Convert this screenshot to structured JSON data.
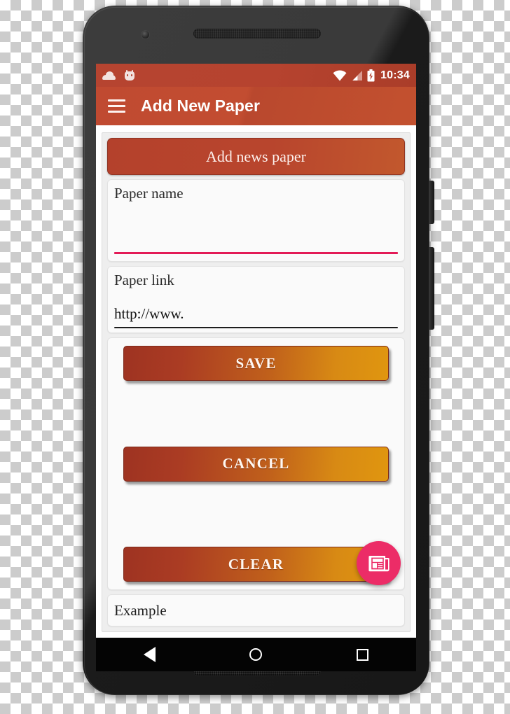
{
  "device": {
    "camera_icon": "camera-dot",
    "earpiece_icon": "earpiece-speaker-grille",
    "bottom_speaker_icon": "bottom-speaker-grille",
    "power_button": "power-button",
    "volume_button": "volume-rocker"
  },
  "status_bar": {
    "left_icons": [
      {
        "name": "cloud-icon"
      },
      {
        "name": "cyanogenmod-robot-icon"
      }
    ],
    "right_icons": [
      {
        "name": "wifi-icon"
      },
      {
        "name": "cellular-signal-icon"
      },
      {
        "name": "battery-charging-icon"
      }
    ],
    "time": "10:34",
    "background_color": "#b6432f"
  },
  "app_bar": {
    "menu_icon": "hamburger-menu-icon",
    "title": "Add New Paper",
    "background_color": "#c04a31",
    "title_color": "#ffffff"
  },
  "form": {
    "section_header": {
      "label": "Add news paper",
      "background_gradient_start": "#b4412c",
      "background_gradient_end": "#c2582d"
    },
    "fields": [
      {
        "label": "Paper name",
        "value": "",
        "placeholder": "Paper name",
        "underline_color": "#e31b57",
        "focused": true
      },
      {
        "label": "Paper link",
        "value": "http://www.",
        "placeholder": "http://www.",
        "underline_color": "#1d1d1d",
        "focused": false
      }
    ],
    "buttons": [
      {
        "label": "SAVE"
      },
      {
        "label": "CANCEL"
      },
      {
        "label": "CLEAR"
      }
    ],
    "button_gradient_start": "#9e3322",
    "button_gradient_end": "#e0960f",
    "example": {
      "label": "Example"
    }
  },
  "fab": {
    "icon": "newspaper-icon",
    "color": "#ec2c67"
  },
  "nav_bar": {
    "buttons": [
      {
        "name": "nav-back-button",
        "icon": "back-triangle-icon"
      },
      {
        "name": "nav-home-button",
        "icon": "home-circle-icon"
      },
      {
        "name": "nav-recents-button",
        "icon": "recents-square-icon"
      }
    ],
    "background_color": "#040404"
  }
}
